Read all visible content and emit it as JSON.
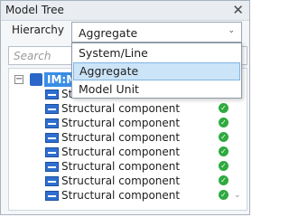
{
  "panel": {
    "title": "Model Tree",
    "close_glyph": "✕"
  },
  "hierarchy": {
    "label": "Hierarchy",
    "selected": "Aggregate",
    "arrow_glyph": "⌄"
  },
  "search": {
    "placeholder": "Search"
  },
  "dropdown": {
    "options": [
      "System/Line",
      "Aggregate",
      "Model Unit"
    ],
    "highlighted_index": 1
  },
  "tree": {
    "root": {
      "expander": "−",
      "label": "IM:Mc"
    },
    "items": [
      {
        "label": "Structural component",
        "status_icon": "✓",
        "visible_text": "Str"
      },
      {
        "label": "Structural component",
        "status_icon": "✓"
      },
      {
        "label": "Structural component",
        "status_icon": "✓"
      },
      {
        "label": "Structural component",
        "status_icon": "✓"
      },
      {
        "label": "Structural component",
        "status_icon": "✓"
      },
      {
        "label": "Structural component",
        "status_icon": "✓"
      },
      {
        "label": "Structural component",
        "status_icon": "✓"
      },
      {
        "label": "Structural component",
        "status_icon": "✓"
      }
    ],
    "overflow_glyph": "⌄"
  },
  "colors": {
    "selection": "#3a8ee6",
    "status_ok": "#2eaa3f",
    "item_icon": "#2f6fd0"
  }
}
